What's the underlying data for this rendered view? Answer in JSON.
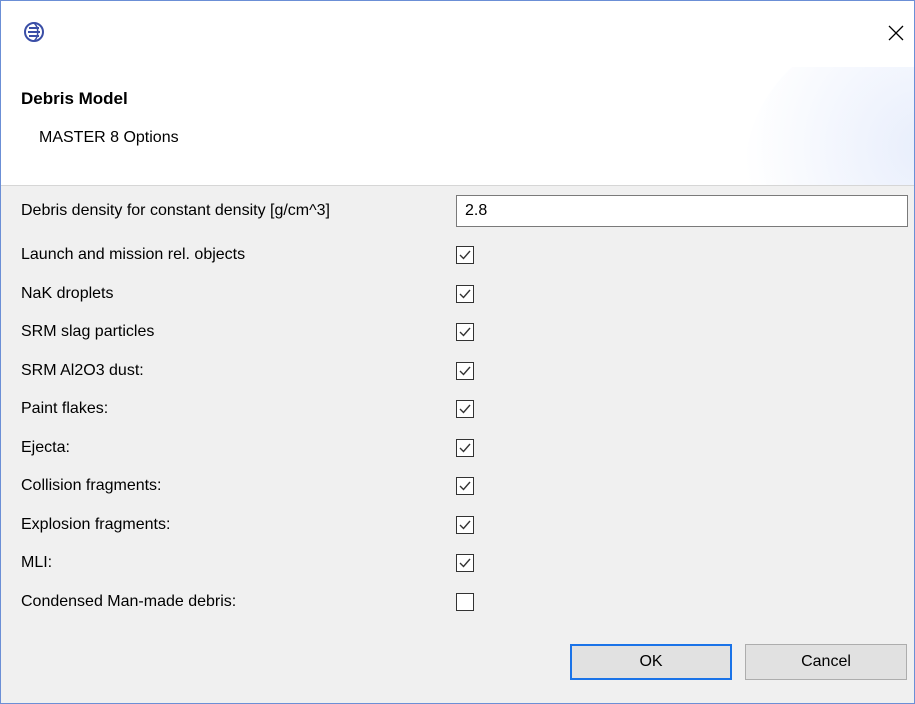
{
  "window": {
    "icon": "eclipse-app-icon",
    "close_icon": "close-icon"
  },
  "banner": {
    "title": "Debris Model",
    "subtitle": "MASTER 8 Options"
  },
  "density": {
    "label": "Debris density for constant density [g/cm^3]",
    "value": "2.8"
  },
  "options": [
    {
      "label": "Launch and mission rel. objects",
      "checked": true
    },
    {
      "label": "NaK droplets",
      "checked": true
    },
    {
      "label": "SRM slag particles",
      "checked": true
    },
    {
      "label": "SRM Al2O3 dust:",
      "checked": true
    },
    {
      "label": "Paint flakes:",
      "checked": true
    },
    {
      "label": "Ejecta:",
      "checked": true
    },
    {
      "label": "Collision fragments:",
      "checked": true
    },
    {
      "label": "Explosion fragments:",
      "checked": true
    },
    {
      "label": "MLI:",
      "checked": true
    },
    {
      "label": "Condensed Man-made debris:",
      "checked": false
    }
  ],
  "buttons": {
    "ok": "OK",
    "cancel": "Cancel"
  },
  "colors": {
    "accent": "#1a73e8",
    "check": "#333333"
  }
}
